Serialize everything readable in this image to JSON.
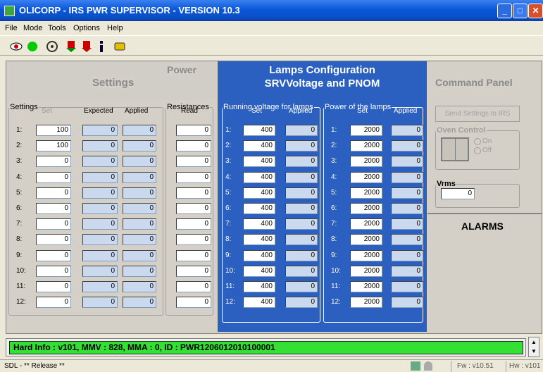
{
  "window": {
    "title": "OLICORP - IRS PWR SUPERVISOR - VERSION 10.3"
  },
  "menu": [
    "File",
    "Mode",
    "Tools",
    "Options",
    "Help"
  ],
  "headers": {
    "power": "Power",
    "settings": "Settings",
    "lamps": "Lamps Configuration",
    "srv": "SRVVoltage and PNOM",
    "command": "Command Panel",
    "alarms": "ALARMS"
  },
  "groups": {
    "settings": "Settings",
    "set": "Set",
    "expected": "Expected",
    "applied": "Applied",
    "resistances": "Resistances",
    "read": "Read",
    "running": "Running voltage for lamps",
    "power_lamps": "Power of the lamps"
  },
  "row_labels": [
    "1:",
    "2:",
    "3:",
    "4:",
    "5:",
    "6:",
    "7:",
    "8:",
    "9:",
    "10:",
    "11:",
    "12:"
  ],
  "set_values": [
    "100",
    "100",
    "0",
    "0",
    "0",
    "0",
    "0",
    "0",
    "0",
    "0",
    "0",
    "0"
  ],
  "expected_values": [
    "0",
    "0",
    "0",
    "0",
    "0",
    "0",
    "0",
    "0",
    "0",
    "0",
    "0",
    "0"
  ],
  "applied_values": [
    "0",
    "0",
    "0",
    "0",
    "0",
    "0",
    "0",
    "0",
    "0",
    "0",
    "0",
    "0"
  ],
  "read_values": [
    "0",
    "0",
    "0",
    "0",
    "0",
    "0",
    "0",
    "0",
    "0",
    "0",
    "0",
    "0"
  ],
  "voltage_set": [
    "400",
    "400",
    "400",
    "400",
    "400",
    "400",
    "400",
    "400",
    "400",
    "400",
    "400",
    "400"
  ],
  "voltage_applied": [
    "0",
    "0",
    "0",
    "0",
    "0",
    "0",
    "0",
    "0",
    "0",
    "0",
    "0",
    "0"
  ],
  "power_set": [
    "2000",
    "2000",
    "2000",
    "2000",
    "2000",
    "2000",
    "2000",
    "2000",
    "2000",
    "2000",
    "2000",
    "2000"
  ],
  "power_applied": [
    "0",
    "0",
    "0",
    "0",
    "0",
    "0",
    "0",
    "0",
    "0",
    "0",
    "0",
    "0"
  ],
  "command": {
    "send_button": "Send Settings to IRS",
    "oven_label": "Oven Control",
    "on": "On",
    "off": "Off",
    "vrms_label": "Vrms",
    "vrms_value": "0"
  },
  "status": {
    "hard_info": "Hard Info : v101, MMV : 828, MMA : 0, ID : PWR1206012010100001",
    "release": "SDL - ** Release **",
    "fw": "Fw : v10.51",
    "hw": "Hw : v101"
  }
}
